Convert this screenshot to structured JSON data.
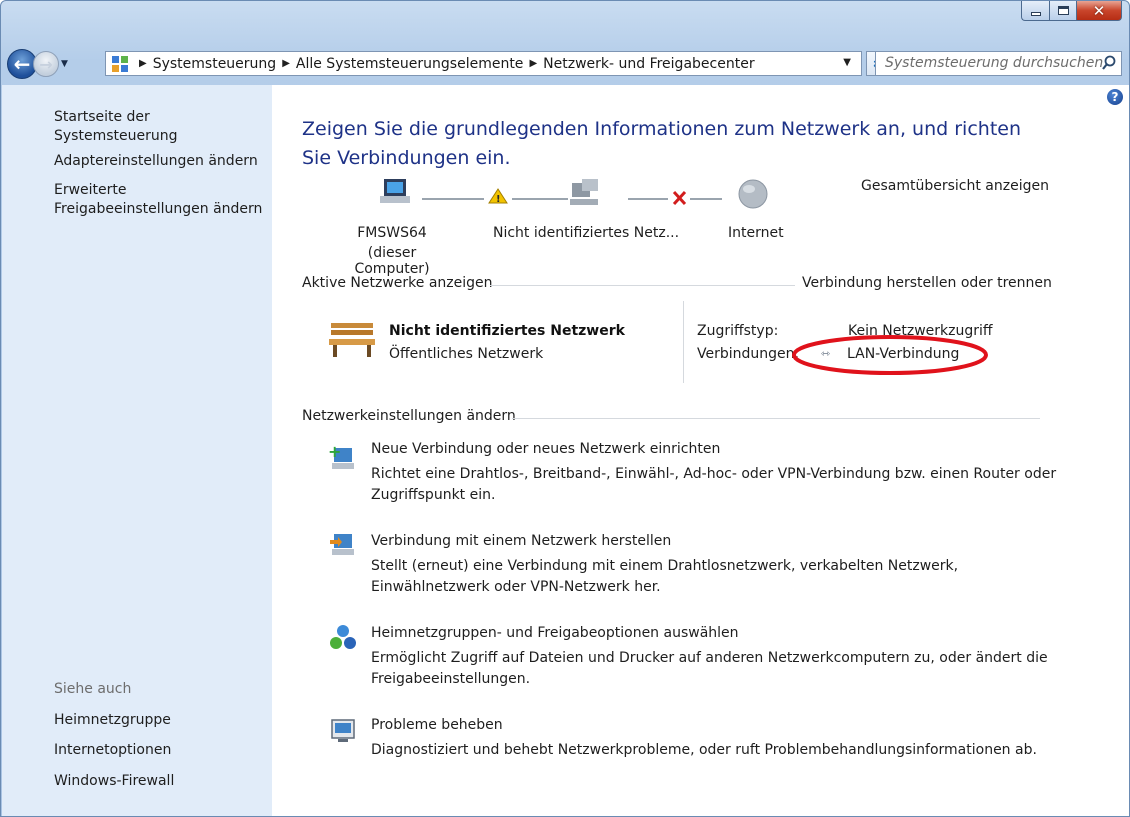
{
  "window": {
    "caption": {
      "close_glyph": "✕"
    }
  },
  "nav": {
    "breadcrumbs": [
      "Systemsteuerung",
      "Alle Systemsteuerungselemente",
      "Netzwerk- und Freigabecenter"
    ],
    "search_placeholder": "Systemsteuerung durchsuchen"
  },
  "sidebar": {
    "top_links": [
      "Startseite der Systemsteuerung",
      "Adaptereinstellungen ändern",
      "Erweiterte Freigabeeinstellungen ändern"
    ],
    "see_also_heading": "Siehe auch",
    "see_also_links": [
      "Heimnetzgruppe",
      "Internetoptionen",
      "Windows-Firewall"
    ]
  },
  "main": {
    "title": "Zeigen Sie die grundlegenden Informationen zum Netzwerk an, und richten Sie Verbindungen ein.",
    "full_map_link": "Gesamtübersicht anzeigen",
    "map": {
      "computer_name": "FMSWS64",
      "computer_note": "(dieser Computer)",
      "network_name": "Nicht identifiziertes Netz...",
      "internet": "Internet"
    },
    "active_networks": {
      "heading": "Aktive Netzwerke anzeigen",
      "connect_link": "Verbindung herstellen oder trennen",
      "network_name": "Nicht identifiziertes Netzwerk",
      "network_type": "Öffentliches Netzwerk",
      "access_type_label": "Zugriffstyp:",
      "access_type_value": "Kein Netzwerkzugriff",
      "connections_label": "Verbindungen:",
      "connection_link": "LAN-Verbindung"
    },
    "change_settings": {
      "heading": "Netzwerkeinstellungen ändern",
      "tasks": [
        {
          "title": "Neue Verbindung oder neues Netzwerk einrichten",
          "desc": "Richtet eine Drahtlos-, Breitband-, Einwähl-, Ad-hoc- oder VPN-Verbindung bzw. einen Router oder Zugriffspunkt ein."
        },
        {
          "title": "Verbindung mit einem Netzwerk herstellen",
          "desc": "Stellt (erneut) eine Verbindung mit einem Drahtlosnetzwerk, verkabelten Netzwerk, Einwählnetzwerk oder VPN-Netzwerk her."
        },
        {
          "title": "Heimnetzgruppen- und Freigabeoptionen auswählen",
          "desc": "Ermöglicht Zugriff auf Dateien und Drucker auf anderen Netzwerkcomputern zu, oder ändert die Freigabeeinstellungen."
        },
        {
          "title": "Probleme beheben",
          "desc": "Diagnostiziert und behebt Netzwerkprobleme, oder ruft Problembehandlungsinformationen ab."
        }
      ]
    }
  },
  "colors": {
    "link": "#1a5fae",
    "title": "#1e3287",
    "sidebar_bg": "#e1ecf9",
    "highlight_circle": "#e0121b"
  }
}
